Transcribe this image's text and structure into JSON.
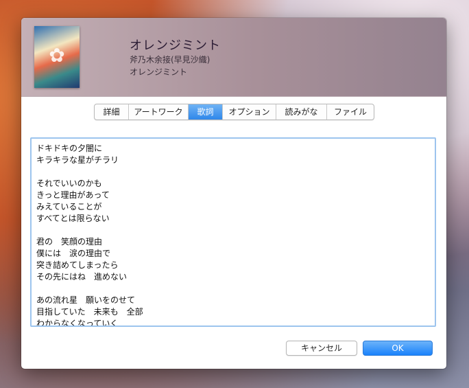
{
  "header": {
    "title": "オレンジミント",
    "artist": "斧乃木余接(早見沙織)",
    "album": "オレンジミント"
  },
  "tabs": [
    {
      "label": "詳細",
      "active": false
    },
    {
      "label": "アートワーク",
      "active": false
    },
    {
      "label": "歌詞",
      "active": true
    },
    {
      "label": "オプション",
      "active": false
    },
    {
      "label": "読みがな",
      "active": false
    },
    {
      "label": "ファイル",
      "active": false
    }
  ],
  "lyrics": "ドキドキの夕闇に\nキラキラな星がチラリ\n\nそれでいいのかも\nきっと理由があって\nみえていることが\nすべてとは限らない\n\n君の　笑顔の理由\n僕には　涙の理由で\n突き詰めてしまったら\nその先にはね　進めない\n\nあの流れ星　願いをのせて\n目指していた　未来も　全部\nわからなくなっていく",
  "buttons": {
    "cancel": "キャンセル",
    "ok": "OK"
  },
  "colors": {
    "accent": "#2f87ea",
    "focus_ring": "#9cc4ee"
  }
}
